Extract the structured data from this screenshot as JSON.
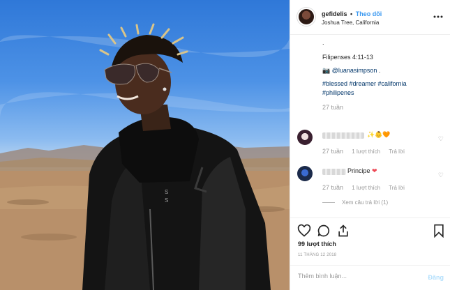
{
  "header": {
    "username": "gefidelis",
    "dot": "•",
    "follow_label": "Theo dõi",
    "location": "Joshua Tree, California",
    "more_icon": "more-horizontal-icon"
  },
  "caption": {
    "dot_line": ".",
    "verse": "Filipenses 4:11-13",
    "camera_emoji": "📷",
    "mention": "@luanasimpson",
    "mention_suffix": " .",
    "hashtags_line1": "#blessed #dreamer #california",
    "hashtags_line2": "#philipenes",
    "time": "27 tuần"
  },
  "comments": [
    {
      "text": "✨👶🧡",
      "time": "27 tuần",
      "likes": "1 lượt thích",
      "reply": "Trả lời"
    },
    {
      "text": "Principe",
      "heart": "❤",
      "time": "27 tuần",
      "likes": "1 lượt thích",
      "reply": "Trả lời"
    }
  ],
  "view_replies": "Xem câu trả lời (1)",
  "likes_count": "99 lượt thích",
  "post_date": "11 THÁNG 12 2018",
  "add_comment": {
    "placeholder": "Thêm bình luận...",
    "post_label": "Đăng"
  },
  "colors": {
    "link_blue": "#3897f0",
    "hashtag": "#003569",
    "heart_red": "#ed4956",
    "muted": "#999999"
  }
}
